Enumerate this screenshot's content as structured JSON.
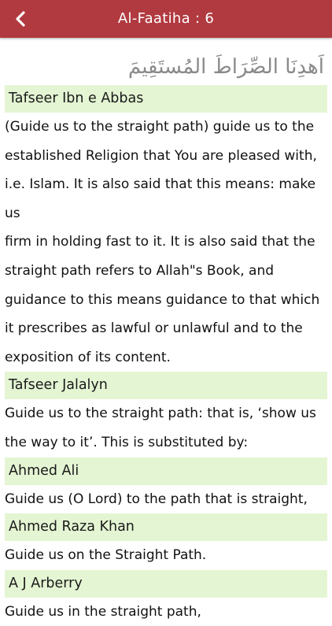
{
  "header": {
    "title": "Al-Faatiha : 6",
    "back_icon": "chevron-left-icon"
  },
  "ayah_text": "اَهدِنَا الصِّرَاطَ المُستَقِيمَ",
  "sections": [
    {
      "heading": "Tafseer Ibn e Abbas",
      "lines": [
        "(Guide us to the straight path) guide us to the",
        "established Religion that You are pleased with,",
        "i.e. Islam. It is also said that this means: make us",
        "firm in holding fast to it. It is also said that the",
        "straight path refers to Allah\"s Book, and",
        "guidance to this means guidance to that which",
        "it prescribes as lawful or unlawful and to the",
        "exposition of its content."
      ]
    },
    {
      "heading": "Tafseer Jalalyn",
      "lines": [
        "Guide us to the straight path: that is, ‘show us",
        "the way to it’. This is substituted by:"
      ]
    },
    {
      "heading": "Ahmed Ali",
      "lines": [
        "Guide us (O Lord) to the path that is straight,"
      ]
    },
    {
      "heading": "Ahmed Raza Khan",
      "lines": [
        "Guide us on the Straight Path."
      ]
    },
    {
      "heading": "A J Arberry",
      "lines": [
        "Guide us in the straight path,"
      ]
    }
  ],
  "colors": {
    "navbar": "#b13a40",
    "section_header_bg": "#e4f5d3",
    "ayah_text": "#8a8a8a"
  }
}
